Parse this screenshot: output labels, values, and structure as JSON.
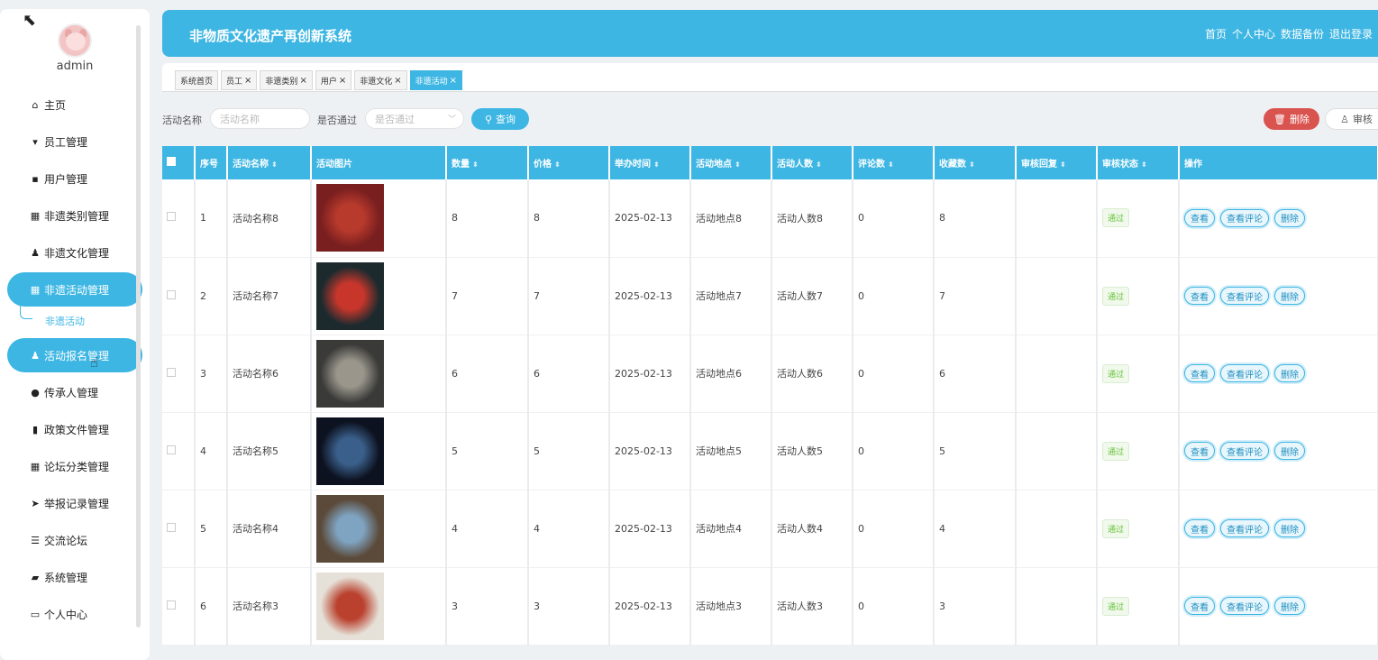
{
  "sidebar": {
    "username": "admin",
    "items": [
      {
        "label": "主页",
        "icon": "home-icon",
        "glyph": "⌂",
        "active": false
      },
      {
        "label": "员工管理",
        "icon": "staff-icon",
        "glyph": "▾",
        "active": false
      },
      {
        "label": "用户管理",
        "icon": "user-icon",
        "glyph": "▪",
        "active": false
      },
      {
        "label": "非遗类别管理",
        "icon": "grid-icon",
        "glyph": "▦",
        "active": false
      },
      {
        "label": "非遗文化管理",
        "icon": "person-icon",
        "glyph": "♟",
        "active": false
      },
      {
        "label": "非遗活动管理",
        "icon": "grid-icon",
        "glyph": "▦",
        "active": true
      },
      {
        "label": "活动报名管理",
        "icon": "person-icon",
        "glyph": "♟",
        "active": true
      },
      {
        "label": "传承人管理",
        "icon": "bulb-icon",
        "glyph": "●",
        "active": false
      },
      {
        "label": "政策文件管理",
        "icon": "bar-chart-icon",
        "glyph": "▮",
        "active": false
      },
      {
        "label": "论坛分类管理",
        "icon": "grid-icon",
        "glyph": "▦",
        "active": false
      },
      {
        "label": "举报记录管理",
        "icon": "send-icon",
        "glyph": "➤",
        "active": false
      },
      {
        "label": "交流论坛",
        "icon": "list-icon",
        "glyph": "☰",
        "active": false
      },
      {
        "label": "系统管理",
        "icon": "briefcase-icon",
        "glyph": "▰",
        "active": false
      },
      {
        "label": "个人中心",
        "icon": "card-icon",
        "glyph": "▭",
        "active": false
      }
    ],
    "submenu_label": "非遗活动"
  },
  "header": {
    "title": "非物质文化遗产再创新系统",
    "links": [
      "首页",
      "个人中心",
      "数据备份",
      "退出登录"
    ]
  },
  "tabs": [
    {
      "label": "系统首页",
      "closable": false,
      "active": false
    },
    {
      "label": "员工",
      "closable": true,
      "active": false
    },
    {
      "label": "非遗类别",
      "closable": true,
      "active": false
    },
    {
      "label": "用户",
      "closable": true,
      "active": false
    },
    {
      "label": "非遗文化",
      "closable": true,
      "active": false
    },
    {
      "label": "非遗活动",
      "closable": true,
      "active": true
    }
  ],
  "search": {
    "name_label": "活动名称",
    "name_placeholder": "活动名称",
    "pass_label": "是否通过",
    "pass_placeholder": "是否通过",
    "query_label": "查询",
    "delete_label": "删除",
    "audit_label": "审核"
  },
  "table": {
    "headers": [
      "序号",
      "活动名称",
      "活动图片",
      "数量",
      "价格",
      "举办时间",
      "活动地点",
      "活动人数",
      "评论数",
      "收藏数",
      "审核回复",
      "审核状态",
      "操作"
    ],
    "rows": [
      {
        "no": "1",
        "name": "活动名称8",
        "qty": "8",
        "price": "8",
        "date": "2025-02-13",
        "place": "活动地点8",
        "people": "活动人数8",
        "comments": "0",
        "fav": "8",
        "reply": "",
        "status": "通过"
      },
      {
        "no": "2",
        "name": "活动名称7",
        "qty": "7",
        "price": "7",
        "date": "2025-02-13",
        "place": "活动地点7",
        "people": "活动人数7",
        "comments": "0",
        "fav": "7",
        "reply": "",
        "status": "通过"
      },
      {
        "no": "3",
        "name": "活动名称6",
        "qty": "6",
        "price": "6",
        "date": "2025-02-13",
        "place": "活动地点6",
        "people": "活动人数6",
        "comments": "0",
        "fav": "6",
        "reply": "",
        "status": "通过"
      },
      {
        "no": "4",
        "name": "活动名称5",
        "qty": "5",
        "price": "5",
        "date": "2025-02-13",
        "place": "活动地点5",
        "people": "活动人数5",
        "comments": "0",
        "fav": "5",
        "reply": "",
        "status": "通过"
      },
      {
        "no": "5",
        "name": "活动名称4",
        "qty": "4",
        "price": "4",
        "date": "2025-02-13",
        "place": "活动地点4",
        "people": "活动人数4",
        "comments": "0",
        "fav": "4",
        "reply": "",
        "status": "通过"
      },
      {
        "no": "6",
        "name": "活动名称3",
        "qty": "3",
        "price": "3",
        "date": "2025-02-13",
        "place": "活动地点3",
        "people": "活动人数3",
        "comments": "0",
        "fav": "3",
        "reply": "",
        "status": "通过"
      }
    ],
    "ops": [
      "查看",
      "查看评论",
      "删除"
    ],
    "thumb_colors": [
      [
        "#7a1f1f",
        "#b83a2c"
      ],
      [
        "#1c2a2e",
        "#c8362b"
      ],
      [
        "#3a3a38",
        "#9a968c"
      ],
      [
        "#0d1220",
        "#3a5f8a"
      ],
      [
        "#5b4a3a",
        "#7fa4c2"
      ],
      [
        "#e6e1d8",
        "#b9412e"
      ]
    ]
  },
  "colors": {
    "accent": "#3eb6e3",
    "danger": "#d9534f",
    "success": "#67c23a"
  }
}
